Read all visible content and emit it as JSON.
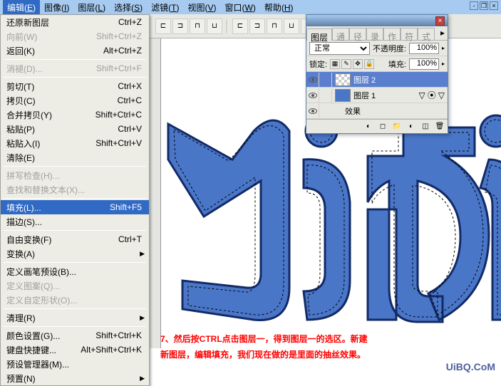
{
  "menubar": {
    "items": [
      {
        "label": "编辑",
        "accel": "E",
        "active": true
      },
      {
        "label": "图像",
        "accel": "I"
      },
      {
        "label": "图层",
        "accel": "L"
      },
      {
        "label": "选择",
        "accel": "S"
      },
      {
        "label": "滤镜",
        "accel": "T"
      },
      {
        "label": "视图",
        "accel": "V"
      },
      {
        "label": "窗口",
        "accel": "W"
      },
      {
        "label": "帮助",
        "accel": "H"
      }
    ]
  },
  "dropdown": {
    "groups": [
      [
        {
          "label": "还原新图层",
          "shortcut": "Ctrl+Z"
        },
        {
          "label": "向前(W)",
          "shortcut": "Shift+Ctrl+Z",
          "disabled": true
        },
        {
          "label": "返回(K)",
          "shortcut": "Alt+Ctrl+Z"
        }
      ],
      [
        {
          "label": "消褪(D)...",
          "shortcut": "Shift+Ctrl+F",
          "disabled": true
        }
      ],
      [
        {
          "label": "剪切(T)",
          "shortcut": "Ctrl+X"
        },
        {
          "label": "拷贝(C)",
          "shortcut": "Ctrl+C"
        },
        {
          "label": "合并拷贝(Y)",
          "shortcut": "Shift+Ctrl+C"
        },
        {
          "label": "粘贴(P)",
          "shortcut": "Ctrl+V"
        },
        {
          "label": "粘贴入(I)",
          "shortcut": "Shift+Ctrl+V"
        },
        {
          "label": "清除(E)"
        }
      ],
      [
        {
          "label": "拼写检查(H)...",
          "disabled": true
        },
        {
          "label": "查找和替换文本(X)...",
          "disabled": true
        }
      ],
      [
        {
          "label": "填充(L)...",
          "shortcut": "Shift+F5",
          "highlighted": true
        },
        {
          "label": "描边(S)..."
        }
      ],
      [
        {
          "label": "自由变换(F)",
          "shortcut": "Ctrl+T"
        },
        {
          "label": "变换(A)",
          "submenu": true
        }
      ],
      [
        {
          "label": "定义画笔预设(B)..."
        },
        {
          "label": "定义图案(Q)...",
          "disabled": true
        },
        {
          "label": "定义自定形状(O)...",
          "disabled": true
        }
      ],
      [
        {
          "label": "清理(R)",
          "submenu": true
        }
      ],
      [
        {
          "label": "颜色设置(G)...",
          "shortcut": "Shift+Ctrl+K"
        },
        {
          "label": "键盘快捷键...",
          "shortcut": "Alt+Shift+Ctrl+K"
        },
        {
          "label": "预设管理器(M)..."
        },
        {
          "label": "预置(N)",
          "submenu": true
        }
      ]
    ]
  },
  "layers_panel": {
    "tabs": [
      "图层",
      "通",
      "径",
      "录",
      "作",
      "符",
      "式"
    ],
    "blend_mode": "正常",
    "opacity_label": "不透明度:",
    "opacity_value": "100%",
    "lock_label": "锁定:",
    "fill_label": "填充:",
    "fill_value": "100%",
    "layers": [
      {
        "name": "图层 2",
        "visible": true,
        "selected": true,
        "thumb": "checker"
      },
      {
        "name": "图层 1",
        "visible": true,
        "thumb": "blue",
        "fx": true
      },
      {
        "name": "效果",
        "effect": true
      }
    ]
  },
  "instruction": {
    "line1": "7、然后按CTRL点击图层一，得到图层一的选区。新建",
    "line2": "新图层，编辑填充，我们现在做的是里面的抽丝效果。"
  },
  "watermark": "UiBQ.CoM"
}
